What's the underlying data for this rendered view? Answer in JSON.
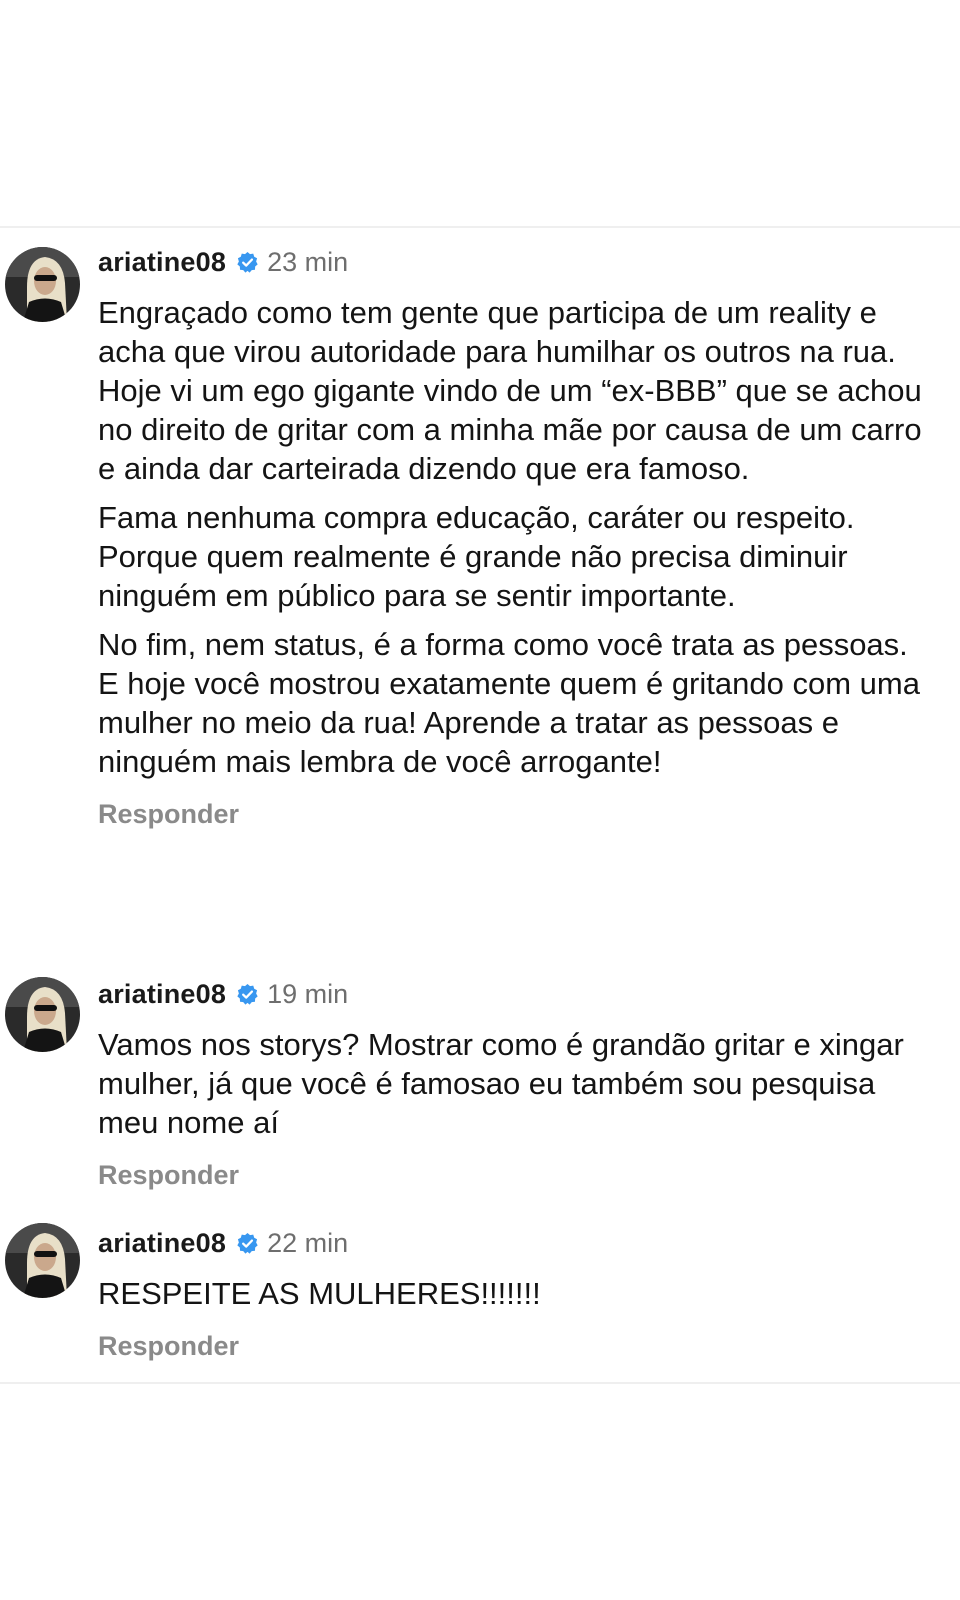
{
  "comments": [
    {
      "username": "ariatine08",
      "time": "23 min",
      "paragraphs": [
        "Engraçado como tem gente que participa de um reality e acha que virou autoridade para humilhar os outros na rua. Hoje vi um ego gigante vindo de um “ex-BBB” que se achou no direito de gritar com a minha mãe por causa de um carro e ainda dar carteirada dizendo que era famoso.",
        "Fama nenhuma compra educação, caráter ou respeito. Porque quem realmente é grande não precisa diminuir ninguém em público para se sentir importante.",
        "No fim, nem status, é a forma como você trata as pessoas. E hoje você mostrou exatamente quem é gritando com uma mulher no meio da rua! Aprende a tratar as pessoas e ninguém mais lembra de você arrogante!"
      ],
      "reply_label": "Responder"
    },
    {
      "username": "ariatine08",
      "time": "19 min",
      "paragraphs": [
        "Vamos nos storys? Mostrar como é grandão gritar e xingar mulher, já que você é famosao eu também sou pesquisa meu nome aí"
      ],
      "reply_label": "Responder"
    },
    {
      "username": "ariatine08",
      "time": "22 min",
      "paragraphs": [
        "RESPEITE AS MULHERES!!!!!!!"
      ],
      "reply_label": "Responder"
    }
  ],
  "colors": {
    "verified_badge": "#3897f0",
    "secondary_text": "#6e6e6e",
    "reply_text": "#8a8a8a"
  },
  "icons": {
    "avatar": "avatar-photo",
    "verified": "verified-badge-icon"
  }
}
